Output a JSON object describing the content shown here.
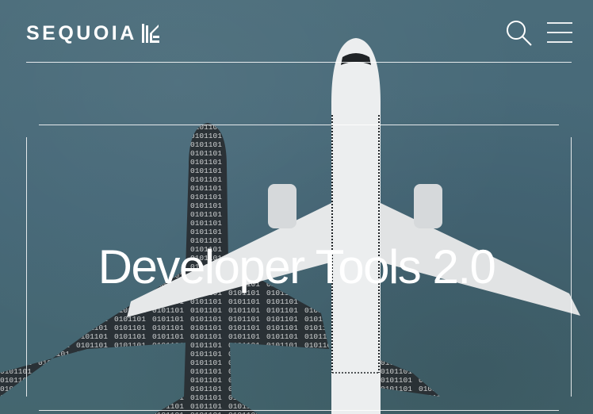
{
  "header": {
    "logo_text": "SEQUOIA",
    "search_label": "Search",
    "menu_label": "Menu"
  },
  "hero": {
    "title": "Developer Tools 2.0",
    "image_icon": "airplane-binary-shadow-image"
  },
  "colors": {
    "background": "#476a78",
    "foreground": "#ffffff",
    "airplane": "#e4e6e7",
    "shadow": "#2c3238"
  }
}
